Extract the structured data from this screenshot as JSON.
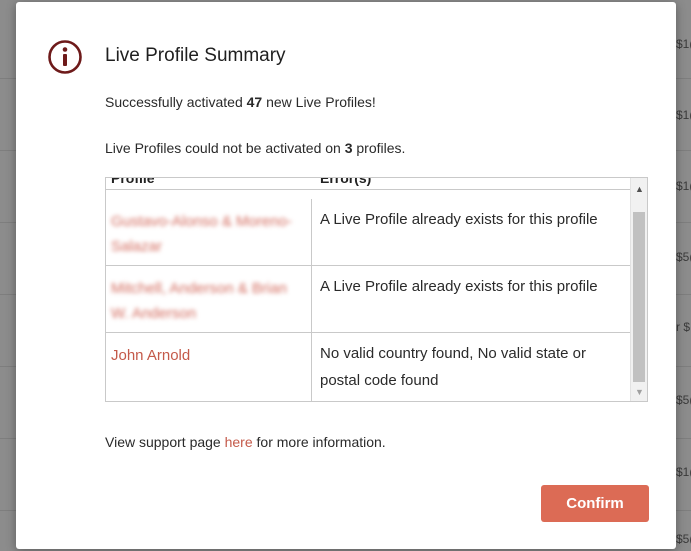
{
  "background": {
    "cells": [
      "$1(",
      "$1(",
      "$1(",
      "$5(",
      "r $",
      "$5(",
      "$1(",
      "$5("
    ]
  },
  "modal": {
    "title": "Live Profile Summary",
    "icon": "info-icon",
    "success_prefix": "Successfully activated ",
    "success_count": "47",
    "success_suffix": " new Live Profiles!",
    "fail_prefix": "Live Profiles could not be activated on ",
    "fail_count": "3",
    "fail_suffix": " profiles.",
    "table": {
      "headers": [
        "Profile",
        "Error(s)"
      ],
      "rows": [
        {
          "profile": "Gustavo-Alonso & Moreno-Salazar",
          "error": "A Live Profile already exists for this profile"
        },
        {
          "profile": "Mitchell, Anderson & Brian W. Anderson",
          "error": "A Live Profile already exists for this profile"
        },
        {
          "profile": "John Arnold",
          "error": "No valid country found, No valid state or postal code found"
        }
      ]
    },
    "support_prefix": "View support page ",
    "support_link": "here",
    "support_suffix": " for more information.",
    "confirm_label": "Confirm"
  },
  "colors": {
    "accent": "#dc6b55",
    "link": "#c45a4a",
    "icon": "#6e1a1a"
  }
}
